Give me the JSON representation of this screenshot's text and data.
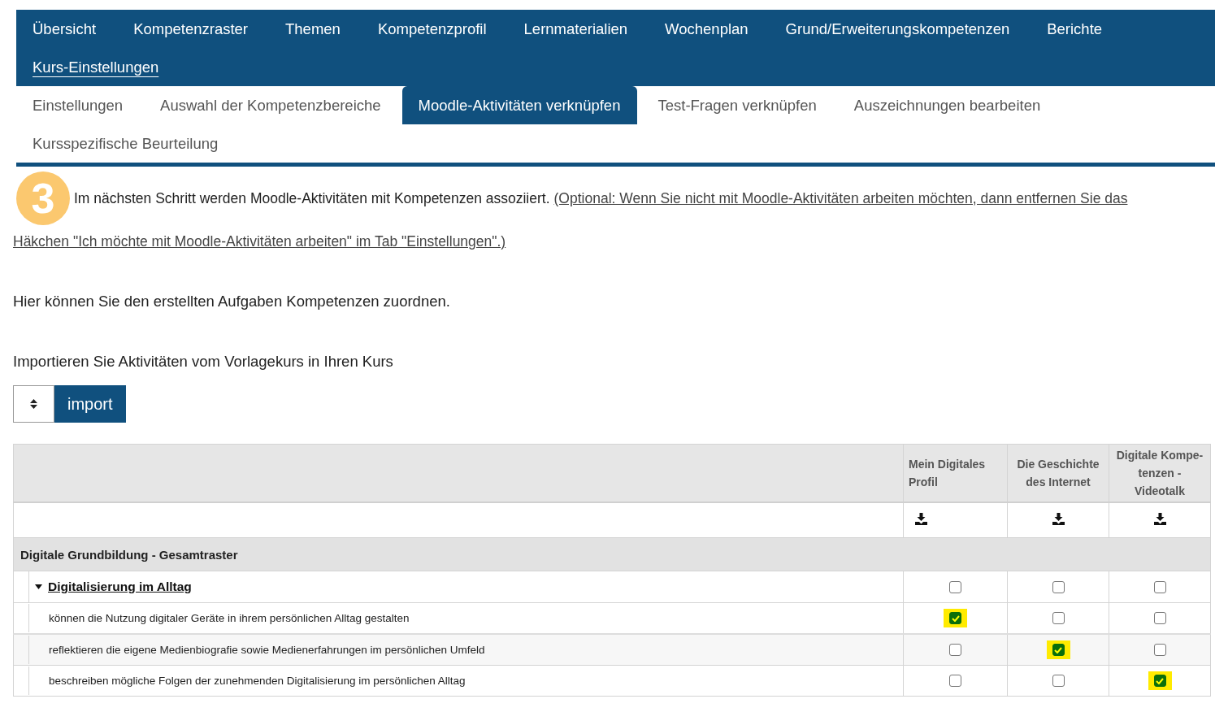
{
  "main_nav": [
    {
      "label": "Übersicht",
      "selected": false
    },
    {
      "label": "Kompetenzraster",
      "selected": false
    },
    {
      "label": "Themen",
      "selected": false
    },
    {
      "label": "Kompetenzprofil",
      "selected": false
    },
    {
      "label": "Lernmaterialien",
      "selected": false
    },
    {
      "label": "Wochenplan",
      "selected": false
    },
    {
      "label": "Grund/Erweiterungskompetenzen",
      "selected": false
    },
    {
      "label": "Berichte",
      "selected": false
    },
    {
      "label": "Kurs-Einstellungen",
      "selected": true
    }
  ],
  "sub_tabs": [
    {
      "label": "Einstellungen",
      "selected": false
    },
    {
      "label": "Auswahl der Kompetenzbereiche",
      "selected": false
    },
    {
      "label": "Moodle-Aktivitäten verknüpfen",
      "selected": true
    },
    {
      "label": "Test-Fragen verknüpfen",
      "selected": false
    },
    {
      "label": "Auszeichnungen bearbeiten",
      "selected": false
    },
    {
      "label": "Kursspezifische Beurteilung",
      "selected": false
    }
  ],
  "step": {
    "number": "3",
    "text": "Im nächsten Schritt werden Moodle-Aktivitäten mit Kompetenzen assoziiert.",
    "link_lines": [
      "(Optional: Wenn Sie nicht mit Moodle-Aktivitäten arbeiten möchten, dann entfernen Sie das",
      "Häkchen \"Ich möchte mit Moodle-Aktivitäten arbeiten\" im Tab \"Einstellungen\".)"
    ]
  },
  "intro": "Hier können Sie den erstellten Aufgaben Kompetenzen zuordnen.",
  "import_hint": "Importieren Sie Aktivitäten vom Vorlagekurs in Ihren Kurs",
  "import_button": "import",
  "table": {
    "columns": [
      "Mein Digitales Profil",
      "Die Geschichte des Internet",
      "Digitale Kompe-tenzen - Videotalk"
    ],
    "section": "Digitale Grundbildung - Gesamtraster",
    "topics": [
      {
        "title": "Digitalisierung im Alltag",
        "expanded": true,
        "checked": [
          false,
          false,
          false
        ],
        "children": [
          {
            "text": "können die Nutzung digitaler Geräte in ihrem persönlichen Alltag gestalten",
            "checked": [
              true,
              false,
              false
            ]
          },
          {
            "text": "reflektieren die eigene Medienbiografie sowie Medienerfahrungen im persönlichen Umfeld",
            "checked": [
              false,
              true,
              false
            ]
          },
          {
            "text": "beschreiben mögliche Folgen der zunehmenden Digitalisierung im persönlichen Alltag",
            "checked": [
              false,
              false,
              true
            ]
          }
        ]
      }
    ]
  }
}
